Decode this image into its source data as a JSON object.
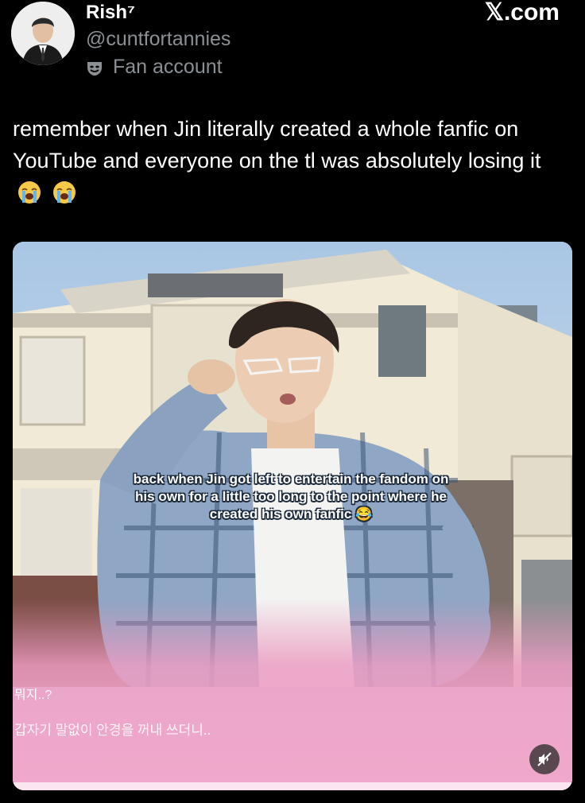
{
  "author": {
    "display_name": "Rish⁷",
    "handle": "@cuntfortannies",
    "label": "Fan account",
    "label_icon": "theater-mask-icon"
  },
  "watermark": "𝕏.com",
  "tweet": {
    "text": "remember when Jin literally created a whole fanfic on YouTube and everyone on the tl was absolutely losing it",
    "emojis": [
      "loudly-crying-face",
      "loudly-crying-face"
    ]
  },
  "media": {
    "caption": "back when Jin got left to entertain the fandom on his own for a little too long to the point where he created his own fanfic 😂",
    "subtitle_line1": "뭐지..?",
    "subtitle_line2": "갑자기 말없이 안경을 꺼내 쓰더니..",
    "mute_icon": "speaker-muted-icon"
  },
  "colors": {
    "background": "#000000",
    "text": "#ffffff",
    "secondary_text": "#8b9095",
    "subtitle_gradient": "#e892b8"
  }
}
